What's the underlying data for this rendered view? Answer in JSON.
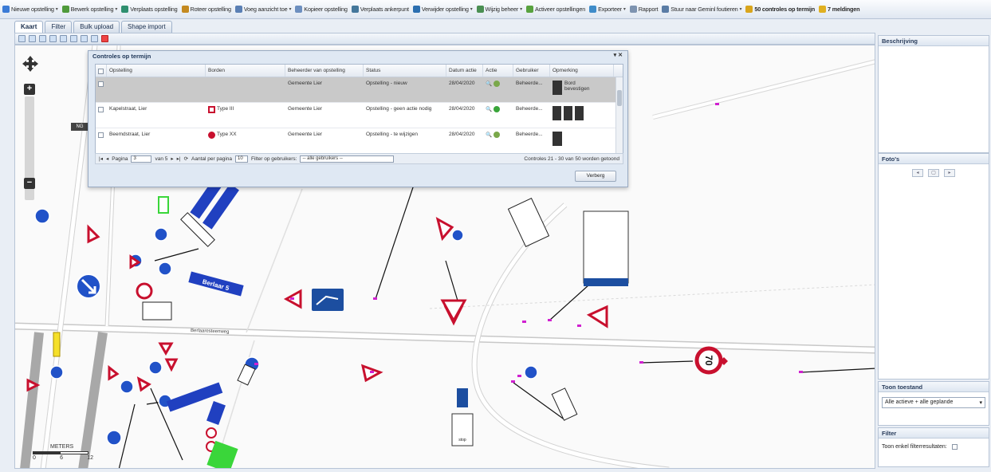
{
  "toolbar": {
    "items": [
      {
        "label": "Nieuwe opstelling",
        "color": "#3b7bd6",
        "arrow": true
      },
      {
        "label": "Bewerk opstelling",
        "color": "#4f9a3b",
        "arrow": true
      },
      {
        "label": "Verplaats opstelling",
        "color": "#2f8f6f",
        "arrow": false
      },
      {
        "label": "Roteer opstelling",
        "color": "#c48a21",
        "arrow": false
      },
      {
        "label": "Voeg aanzicht toe",
        "color": "#5a7fb4",
        "arrow": true
      },
      {
        "label": "Kopieer opstelling",
        "color": "#6d8fbf",
        "arrow": false
      },
      {
        "label": "Verplaats ankerpunt",
        "color": "#44779b",
        "arrow": false
      },
      {
        "label": "Verwijder opstelling",
        "color": "#2c6fb0",
        "arrow": true
      },
      {
        "label": "Wijzig beheer",
        "color": "#4a8f52",
        "arrow": true
      },
      {
        "label": "Activeer opstellingen",
        "color": "#58a23f",
        "arrow": false
      },
      {
        "label": "Exporteer",
        "color": "#3f8cc9",
        "arrow": true
      },
      {
        "label": "Rapport",
        "color": "#7d93b0",
        "arrow": false
      },
      {
        "label": "Stuur naar Geminl foutieren",
        "color": "#5a7ca5",
        "arrow": true
      },
      {
        "label": "50 controles op termijn",
        "color": "#d9a51c",
        "arrow": false,
        "bold": true
      },
      {
        "label": "7 meldingen",
        "color": "#e0b020",
        "arrow": false,
        "bold": true
      }
    ]
  },
  "tabs": [
    "Kaart",
    "Filter",
    "Bulk upload",
    "Shape import"
  ],
  "map": {
    "road_label": "Berlaaresteenweg",
    "scale": {
      "title": "METERS",
      "ticks": [
        "0",
        "6",
        "12"
      ]
    },
    "nav_badge": "NG",
    "sign_labels": [
      "70",
      "Berlaar 5",
      "stop"
    ]
  },
  "dialog": {
    "title": "Controles op termijn",
    "columns": [
      "Opstelling",
      "Borden",
      "Beheerder van opstelling",
      "Status",
      "Datum actie",
      "Actie",
      "Gebruiker",
      "Opmerking"
    ],
    "rows": [
      {
        "opstelling": "",
        "borden": "",
        "beheerder": "Gemeente Lier",
        "status": "Opstelling - nieuw",
        "datum": "28/04/2020",
        "gebruiker": "Beheerde...",
        "opmerking": "Bord bevestigen",
        "selected": true
      },
      {
        "opstelling": "Kapelstraat, Lier",
        "borden": "Type III",
        "beheerder": "Gemeente Lier",
        "status": "Opstelling - geen actie nodig",
        "datum": "28/04/2020",
        "gebruiker": "Beheerde...",
        "opmerking": "",
        "selected": false
      },
      {
        "opstelling": "Beemdstraat, Lier",
        "borden": "Type XX",
        "beheerder": "Gemeente Lier",
        "status": "Opstelling - te wijzigen",
        "datum": "28/04/2020",
        "gebruiker": "Beheerde...",
        "opmerking": "",
        "selected": false
      }
    ],
    "pager": {
      "page_label": "Pagina",
      "page_value": "3",
      "page_of": "van 5",
      "per_page_label": "Aantal per pagina",
      "per_page_value": "10",
      "filter_label": "Filter op gebruikers:",
      "filter_value": "-- alle gebruikers --",
      "summary": "Controles 21 - 30 van 50 worden getoond"
    },
    "close_label": "Verberg"
  },
  "right_panel": {
    "description_title": "Beschrijving",
    "photos_title": "Foto's",
    "state_title": "Toon toestand",
    "state_value": "Alle actieve + alle geplande",
    "filter_title": "Filter",
    "filter_checkbox_label": "Toon enkel filterresultaten:"
  }
}
